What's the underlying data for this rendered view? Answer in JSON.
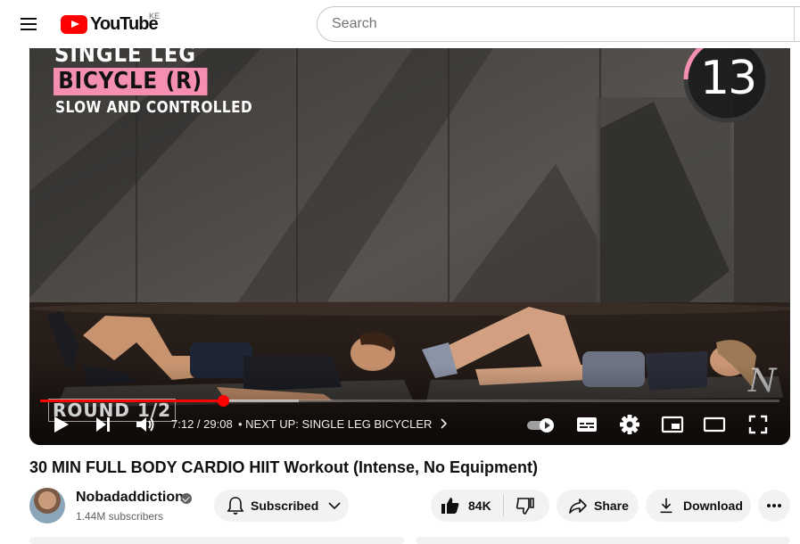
{
  "header": {
    "logo_text": "YouTube",
    "country_code": "KE",
    "search_placeholder": "Search"
  },
  "player": {
    "overlay_line1": "SINGLE LEG",
    "overlay_line2": "BICYCLE (R)",
    "overlay_line3": "SLOW AND CONTROLLED",
    "timer_value": "13",
    "timer_progress": 0.18,
    "round_label": "ROUND 1/2",
    "current_time": "7:12",
    "duration": "29:08",
    "time_separator": " / ",
    "next_up": "NEXT UP: SINGLE LEG BICYCLER",
    "progress_played": 0.247,
    "progress_loaded": 0.35,
    "accent_color": "#ff0000",
    "overlay_pink": "#f48fb1"
  },
  "video": {
    "title": "30 MIN FULL BODY CARDIO HIIT Workout (Intense, No Equipment)",
    "channel_name": "Nobadaddiction",
    "subscribers": "1.44M subscribers",
    "subscribed_label": "Subscribed",
    "like_count": "84K",
    "share_label": "Share",
    "download_label": "Download"
  },
  "icons": [
    "menu-icon",
    "youtube-logo-icon",
    "play-icon",
    "next-icon",
    "volume-icon",
    "chevron-right-icon",
    "autoplay-toggle-icon",
    "subtitles-icon",
    "settings-icon",
    "miniplayer-icon",
    "theater-icon",
    "fullscreen-icon",
    "bell-icon",
    "chevron-down-icon",
    "like-icon",
    "dislike-icon",
    "share-icon",
    "download-icon",
    "more-icon",
    "verified-icon"
  ]
}
